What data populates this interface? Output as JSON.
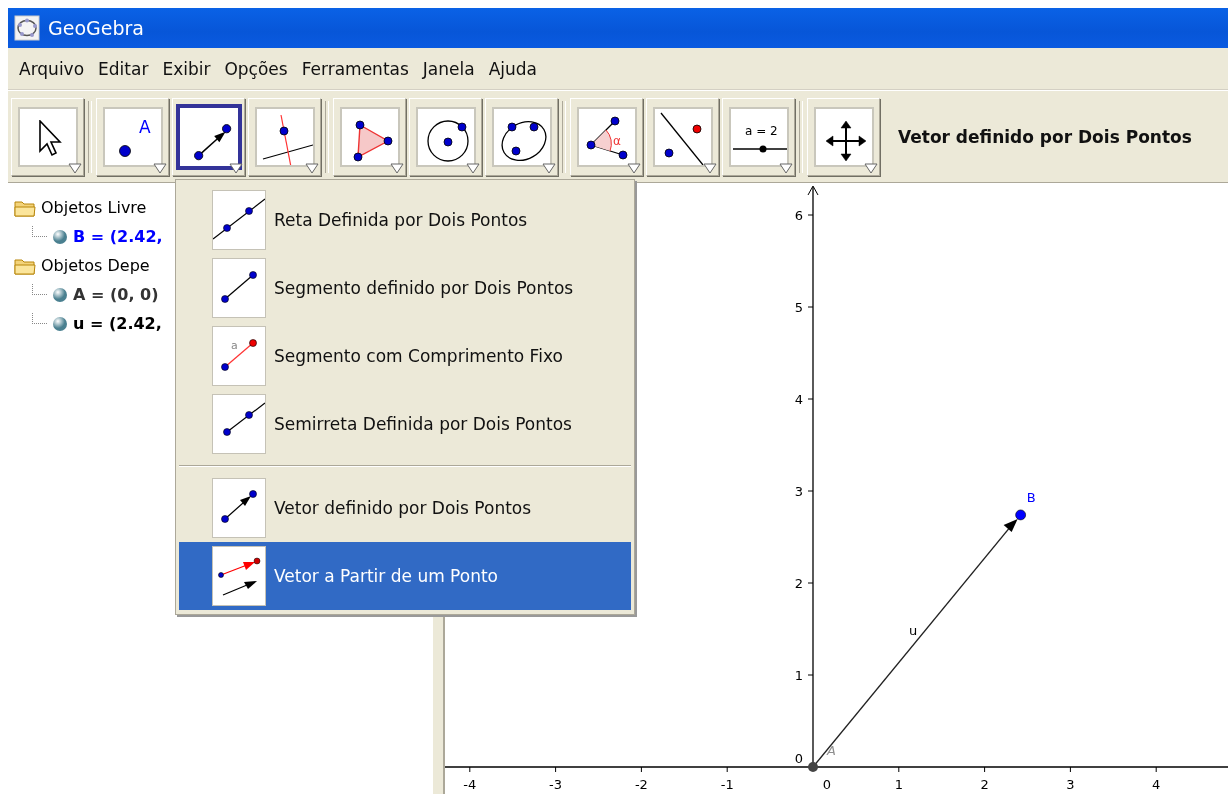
{
  "window": {
    "title": "GeoGebra"
  },
  "menu": [
    "Arquivo",
    "Editar",
    "Exibir",
    "Opções",
    "Ferramentas",
    "Janela",
    "Ajuda"
  ],
  "toolbar": {
    "groups": [
      [
        {
          "kind": "pointer",
          "selected": false
        }
      ],
      [
        {
          "kind": "point",
          "selected": false,
          "text": "A"
        },
        {
          "kind": "vector",
          "selected": true
        },
        {
          "kind": "perpendicular",
          "selected": false
        }
      ],
      [
        {
          "kind": "polygon",
          "selected": false
        },
        {
          "kind": "circle",
          "selected": false
        },
        {
          "kind": "conic",
          "selected": false
        }
      ],
      [
        {
          "kind": "angle",
          "selected": false,
          "text": "α"
        },
        {
          "kind": "reflect",
          "selected": false
        },
        {
          "kind": "slider",
          "selected": false,
          "text": "a = 2"
        }
      ],
      [
        {
          "kind": "move",
          "selected": false
        }
      ]
    ],
    "tool_name": "Vetor definido por Dois Pontos"
  },
  "algebra": [
    {
      "label": "Objetos Livre",
      "children": [
        {
          "label": "B = (2.42,",
          "color": "#0000ff"
        }
      ]
    },
    {
      "label": "Objetos Depe",
      "children": [
        {
          "label": "A = (0, 0)",
          "color": "#333333"
        },
        {
          "label": "u = (2.42,",
          "color": "#000000"
        }
      ]
    }
  ],
  "tool_menu": {
    "sections": [
      [
        {
          "kind": "line",
          "label": "Reta Definida por Dois Pontos",
          "selected": false
        },
        {
          "kind": "segment",
          "label": "Segmento definido por Dois Pontos",
          "selected": false
        },
        {
          "kind": "fixed-segment",
          "label": "Segmento com Comprimento Fixo",
          "selected": false,
          "text": "a"
        },
        {
          "kind": "ray",
          "label": "Semirreta Definida por Dois Pontos",
          "selected": false
        }
      ],
      [
        {
          "kind": "vector",
          "label": "Vetor definido por Dois Pontos",
          "selected": false
        },
        {
          "kind": "vector-from-point",
          "label": "Vetor a Partir de um Ponto",
          "selected": true
        }
      ]
    ]
  },
  "graphics": {
    "x_ticks": [
      "-4",
      "-3",
      "-2",
      "-1",
      "0",
      "1",
      "2",
      "3",
      "4"
    ],
    "y_ticks": [
      "6",
      "5",
      "4",
      "3",
      "2",
      "1",
      "0"
    ],
    "points": [
      {
        "label": "A",
        "color": "#444444"
      },
      {
        "label": "B",
        "color": "#0000ff"
      }
    ],
    "vector": {
      "label": "u"
    }
  }
}
